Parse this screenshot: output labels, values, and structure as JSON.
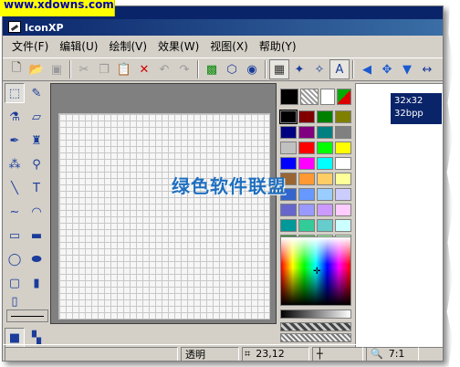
{
  "watermark": {
    "text": "www.xdowns.com"
  },
  "window": {
    "title": "IconXP"
  },
  "menu": {
    "items": [
      "文件(F)",
      "编辑(U)",
      "绘制(V)",
      "效果(W)",
      "视图(X)",
      "帮助(Y)"
    ]
  },
  "formats": {
    "line1": "32x32",
    "line2": "32bpp"
  },
  "status": {
    "transparency": "透明",
    "coords": "23,12",
    "zoom": "7:1"
  },
  "overlay": {
    "text": "绿色软件联盟"
  },
  "palette": {
    "current_fg": "#000000",
    "rows": [
      [
        "#000000",
        "#800000",
        "#008000",
        "#808000"
      ],
      [
        "#000080",
        "#800080",
        "#008080",
        "#808080"
      ],
      [
        "#c0c0c0",
        "#ff0000",
        "#00ff00",
        "#ffff00"
      ],
      [
        "#0000ff",
        "#ff00ff",
        "#00ffff",
        "#ffffff"
      ],
      [
        "#996633",
        "#ff9933",
        "#ffcc66",
        "#ffff99"
      ],
      [
        "#3366cc",
        "#6699ff",
        "#99ccff",
        "#ccccff"
      ],
      [
        "#6666cc",
        "#9999ff",
        "#cc99ff",
        "#ffccff"
      ],
      [
        "#009999",
        "#33cc99",
        "#66cccc",
        "#ccffff"
      ],
      [
        "#339933",
        "#66cc66",
        "#99ff99",
        "#ccffcc"
      ]
    ]
  }
}
